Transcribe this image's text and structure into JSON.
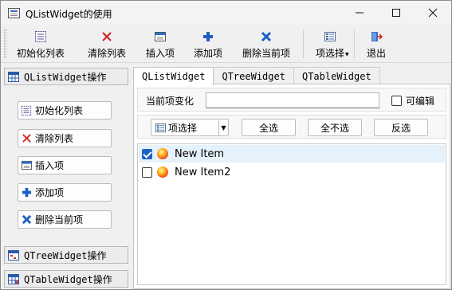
{
  "window": {
    "title": "QListWidget的使用"
  },
  "titlebar_buttons": {
    "minimize": "—",
    "maximize": "☐",
    "close": "✕"
  },
  "toolbar": {
    "items": [
      {
        "label": "初始化列表",
        "icon": "list-init-icon"
      },
      {
        "label": "清除列表",
        "icon": "clear-x-icon"
      },
      {
        "label": "插入项",
        "icon": "insert-icon"
      },
      {
        "label": "添加项",
        "icon": "add-plus-icon"
      },
      {
        "label": "删除当前项",
        "icon": "delete-x-icon"
      },
      {
        "label": "项选择",
        "icon": "select-icon"
      },
      {
        "label": "退出",
        "icon": "exit-icon"
      }
    ]
  },
  "left_panel": {
    "sections": [
      {
        "label": "QListWidget操作"
      },
      {
        "label": "QTreeWidget操作"
      },
      {
        "label": "QTableWidget操作"
      }
    ],
    "buttons": [
      {
        "label": "初始化列表"
      },
      {
        "label": "清除列表"
      },
      {
        "label": "插入项"
      },
      {
        "label": "添加项"
      },
      {
        "label": "删除当前项"
      }
    ]
  },
  "tabs": [
    {
      "label": "QListWidget",
      "active": true
    },
    {
      "label": "QTreeWidget",
      "active": false
    },
    {
      "label": "QTableWidget",
      "active": false
    }
  ],
  "current_change": {
    "label": "当前项变化",
    "value": ""
  },
  "editable": {
    "label": "可编辑",
    "checked": false
  },
  "selection_bar": {
    "dropdown_label": "项选择",
    "select_all": "全选",
    "select_none": "全不选",
    "invert": "反选"
  },
  "list_items": [
    {
      "text": "New Item",
      "checked": true,
      "selected": true
    },
    {
      "text": "New Item2",
      "checked": false,
      "selected": false
    }
  ],
  "colors": {
    "accent": "#1e61c4",
    "selection": "#e5f1fb",
    "delete_blue": "#1c5fc4",
    "clear_red": "#d02020"
  }
}
